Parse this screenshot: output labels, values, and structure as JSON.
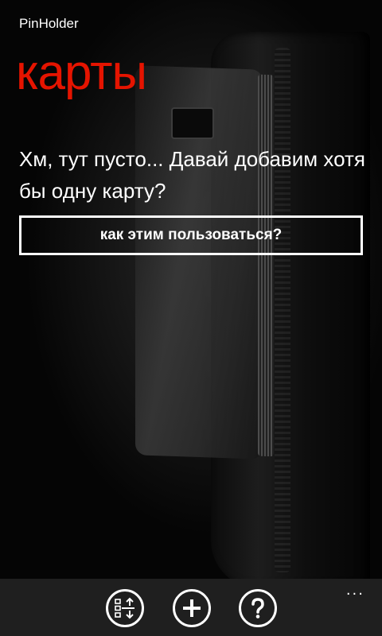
{
  "app": {
    "title": "PinHolder"
  },
  "page": {
    "title": "карты"
  },
  "empty_state": {
    "message": "Хм, тут пусто... Давай добавим хотя бы одну карту?",
    "help_button_label": "как этим пользоваться?"
  },
  "app_bar": {
    "buttons": [
      {
        "icon": "reorder-icon"
      },
      {
        "icon": "add-icon"
      },
      {
        "icon": "help-icon"
      }
    ],
    "more_label": "..."
  },
  "colors": {
    "accent": "#e51400",
    "background": "#000000",
    "app_bar": "#1f1f1f",
    "text": "#ffffff"
  }
}
